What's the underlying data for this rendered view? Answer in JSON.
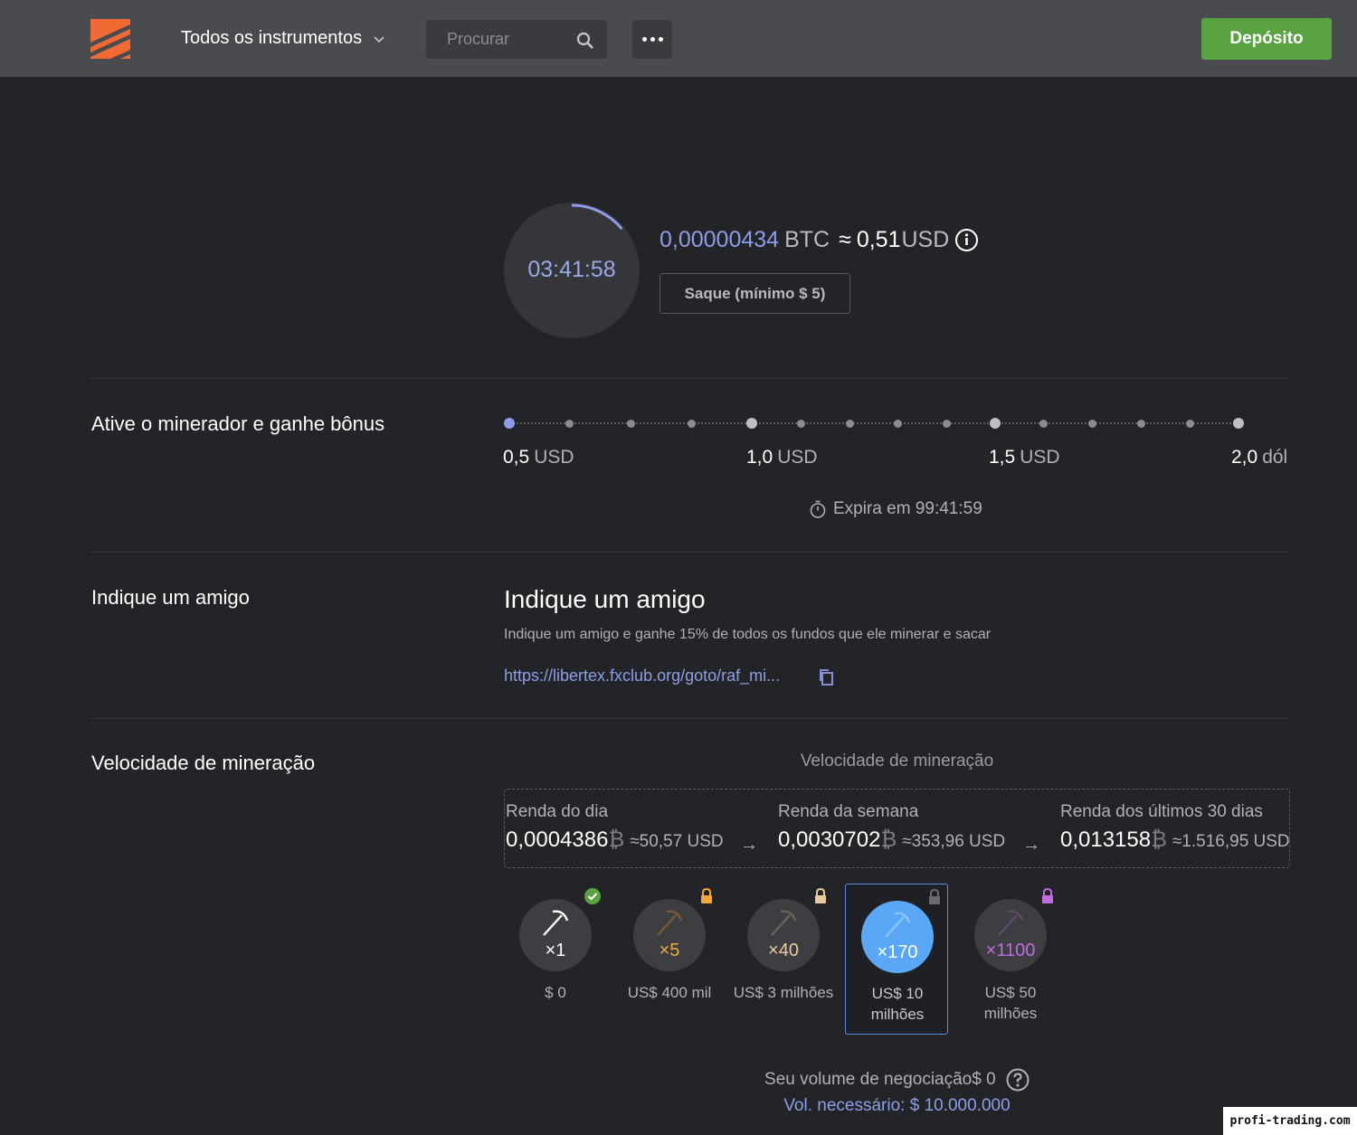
{
  "header": {
    "instruments_label": "Todos os instrumentos",
    "search_placeholder": "Procurar",
    "deposit_label": "Depósito"
  },
  "miner": {
    "timer": "03:41:58",
    "btc_value": "0,00000434",
    "btc_unit": "BTC",
    "approx": "≈",
    "usd_value": "0,51",
    "usd_unit": "USD",
    "withdraw_label": "Saque (mínimo $ 5)",
    "timer_progress": 0.14
  },
  "bonus": {
    "title": "Ative o minerador e ganhe bônus",
    "milestones": [
      {
        "num": "0,5",
        "unit": "USD"
      },
      {
        "num": "1,0",
        "unit": "USD"
      },
      {
        "num": "1,5",
        "unit": "USD"
      },
      {
        "num": "2,0",
        "unit": "dól"
      }
    ],
    "expire": "Expira em 99:41:59"
  },
  "refer": {
    "section_title": "Indique um amigo",
    "heading": "Indique um amigo",
    "description": "Indique um amigo e ganhe 15% de todos os fundos que ele minerar e sacar",
    "link": "https://libertex.fxclub.org/goto/raf_mi..."
  },
  "mining": {
    "section_title": "Velocidade de mineração",
    "subtitle": "Velocidade de mineração",
    "btc_symbol": "₿",
    "incomes": [
      {
        "label": "Renda do dia",
        "value": "0,0004386",
        "usd": "≈50,57 USD"
      },
      {
        "label": "Renda da semana",
        "value": "0,0030702",
        "usd": "≈353,96 USD"
      },
      {
        "label": "Renda dos últimos 30 dias",
        "value": "0,013158",
        "usd": "≈1.516,95 USD"
      }
    ],
    "arrow": "→",
    "tiers": [
      {
        "mult": "×1",
        "price": "$ 0",
        "color": "#ffffff",
        "status": "unlocked"
      },
      {
        "mult": "×5",
        "price": "US$ 400 mil",
        "color": "#f2a93b",
        "status": "locked"
      },
      {
        "mult": "×40",
        "price": "US$ 3 milhões",
        "color": "#e8c9a0",
        "status": "locked"
      },
      {
        "mult": "×170",
        "price": "US$ 10 milhões",
        "color": "#ffffff",
        "status": "locked"
      },
      {
        "mult": "×1100",
        "price": "US$ 50 milhões",
        "color": "#c06be0",
        "status": "locked"
      }
    ],
    "volume_label": "Seu volume de negociação$ 0",
    "volume_required": "Vol. necessário: $ 10.000.000"
  },
  "watermark": "profi-trading.com"
}
